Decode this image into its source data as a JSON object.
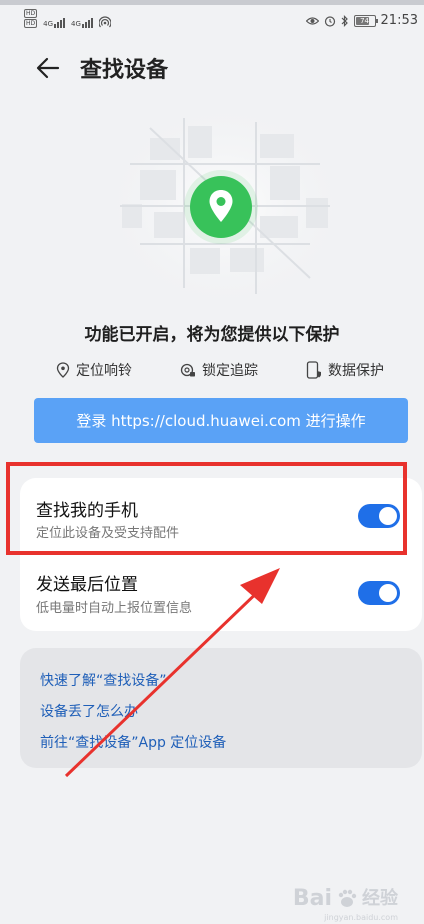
{
  "status_bar": {
    "sim1_tag": "HD",
    "sim2_tag": "HD",
    "network1": "4G",
    "network2": "4G",
    "battery": "74",
    "time": "21:53"
  },
  "header": {
    "title": "查找设备"
  },
  "status_text": "功能已开启，将为您提供以下保护",
  "features": [
    {
      "label": "定位响铃",
      "icon": "location-pin-icon"
    },
    {
      "label": "锁定追踪",
      "icon": "lock-track-icon"
    },
    {
      "label": "数据保护",
      "icon": "phone-shield-icon"
    }
  ],
  "login_button": "登录 https://cloud.huawei.com 进行操作",
  "settings": [
    {
      "title": "查找我的手机",
      "subtitle": "定位此设备及受支持配件",
      "enabled": true
    },
    {
      "title": "发送最后位置",
      "subtitle": "低电量时自动上报位置信息",
      "enabled": true
    }
  ],
  "links": [
    "快速了解“查找设备”",
    "设备丢了怎么办",
    "前往“查找设备”App 定位设备"
  ],
  "watermark": {
    "text": "Bai",
    "cn": "经验",
    "url": "jingyan.baidu.com"
  },
  "colors": {
    "accent": "#1f6fe8",
    "button": "#5aa2f6",
    "pin": "#38c25a",
    "highlight": "#e8322d",
    "link": "#1f5fb8"
  }
}
